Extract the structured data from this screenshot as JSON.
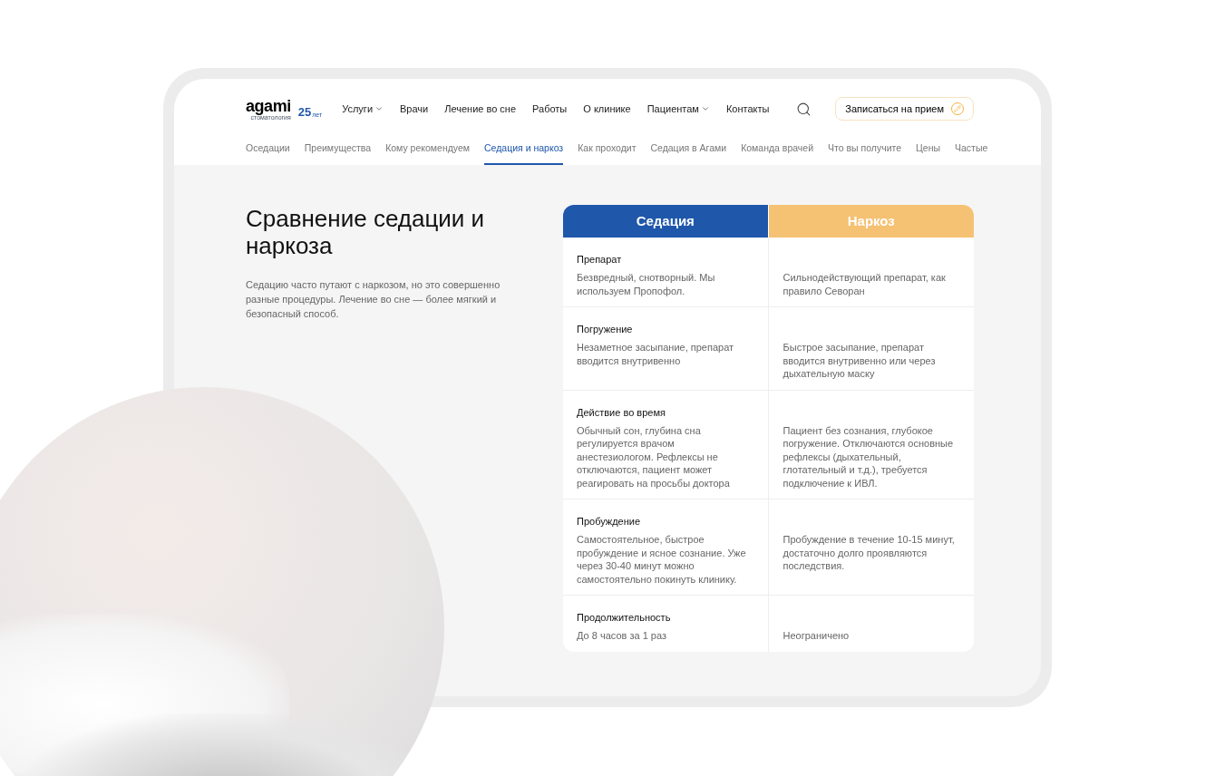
{
  "header": {
    "logo": {
      "name": "agami",
      "tagline": "стоматология",
      "years": "25",
      "years_unit": "лет"
    },
    "nav": [
      {
        "label": "Услуги",
        "kind": "dropdown"
      },
      {
        "label": "Врачи",
        "kind": "link"
      },
      {
        "label": "Лечение во сне",
        "kind": "link"
      },
      {
        "label": "Работы",
        "kind": "link"
      },
      {
        "label": "О клинике",
        "kind": "link"
      },
      {
        "label": "Пациентам",
        "kind": "dropdown"
      },
      {
        "label": "Контакты",
        "kind": "link"
      }
    ],
    "cta": "Записаться на прием"
  },
  "subnav": [
    {
      "label": "Оседации",
      "selected": false
    },
    {
      "label": "Преимущества",
      "selected": false
    },
    {
      "label": "Кому рекомендуем",
      "selected": false
    },
    {
      "label": "Седация и наркоз",
      "selected": true
    },
    {
      "label": "Как проходит",
      "selected": false
    },
    {
      "label": "Седация в Агами",
      "selected": false
    },
    {
      "label": "Команда врачей",
      "selected": false
    },
    {
      "label": "Что вы получите",
      "selected": false
    },
    {
      "label": "Цены",
      "selected": false
    },
    {
      "label": "Частые",
      "selected": false
    }
  ],
  "section": {
    "title": "Сравнение седации и наркоза",
    "text": "Седацию часто путают с наркозом, но это совершенно разные процедуры. Лечение во сне — более мягкий и безопасный способ."
  },
  "table": {
    "columns": [
      {
        "label": "Седация",
        "color": "#1f57ab"
      },
      {
        "label": "Наркоз",
        "color": "#f5c173"
      }
    ],
    "rows": [
      {
        "label": "Препарат",
        "sedation": "Безвредный, снотворный. Мы используем Пропофол.",
        "narcosis": "Сильнодействующий препарат, как правило Севоран"
      },
      {
        "label": "Погружение",
        "sedation": "Незаметное засыпание, препарат вводится внутривенно",
        "narcosis": "Быстрое засыпание, препарат вводится внутривенно или через дыхательную маску"
      },
      {
        "label": "Действие во время",
        "sedation": "Обычный сон, глубина сна регулируется врачом анестезиологом. Рефлексы не отключаются, пациент может реагировать на просьбы доктора",
        "narcosis": "Пациент без сознания, глубокое погружение. Отключаются основные рефлексы (дыхательный, глотательный и т.д.), требуется подключение к ИВЛ."
      },
      {
        "label": "Пробуждение",
        "sedation": "Самостоятельное, быстрое пробуждение и ясное сознание. Уже через 30-40 минут можно самостоятельно покинуть клинику.",
        "narcosis": "Пробуждение в течение 10-15 минут, достаточно долго проявляются последствия."
      },
      {
        "label": "Продолжительность",
        "sedation": "До 8 часов за 1 раз",
        "narcosis": "Неограничено"
      }
    ]
  }
}
